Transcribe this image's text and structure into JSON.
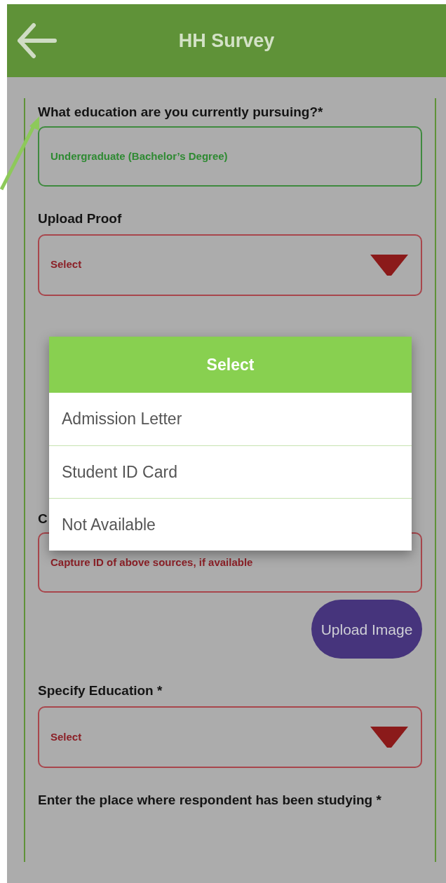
{
  "header": {
    "title": "HH Survey"
  },
  "fields": [
    {
      "kind": "filled",
      "label": "What education are you currently pursuing?*",
      "value": "Undergraduate (Bachelor’s Degree)"
    },
    {
      "kind": "select",
      "label": "Upload Proof",
      "value": "Select"
    },
    {
      "kind": "text",
      "label": "C",
      "placeholder": "Capture ID of above sources, if available"
    },
    {
      "kind": "button",
      "label": "Upload Image"
    },
    {
      "kind": "select",
      "label": "Specify Education *",
      "value": "Select"
    },
    {
      "kind": "label",
      "label": "Enter the place where respondent has been studying *"
    }
  ],
  "dialog": {
    "title": "Select",
    "options": [
      "Admission Letter",
      "Student ID Card",
      "Not Available"
    ]
  }
}
